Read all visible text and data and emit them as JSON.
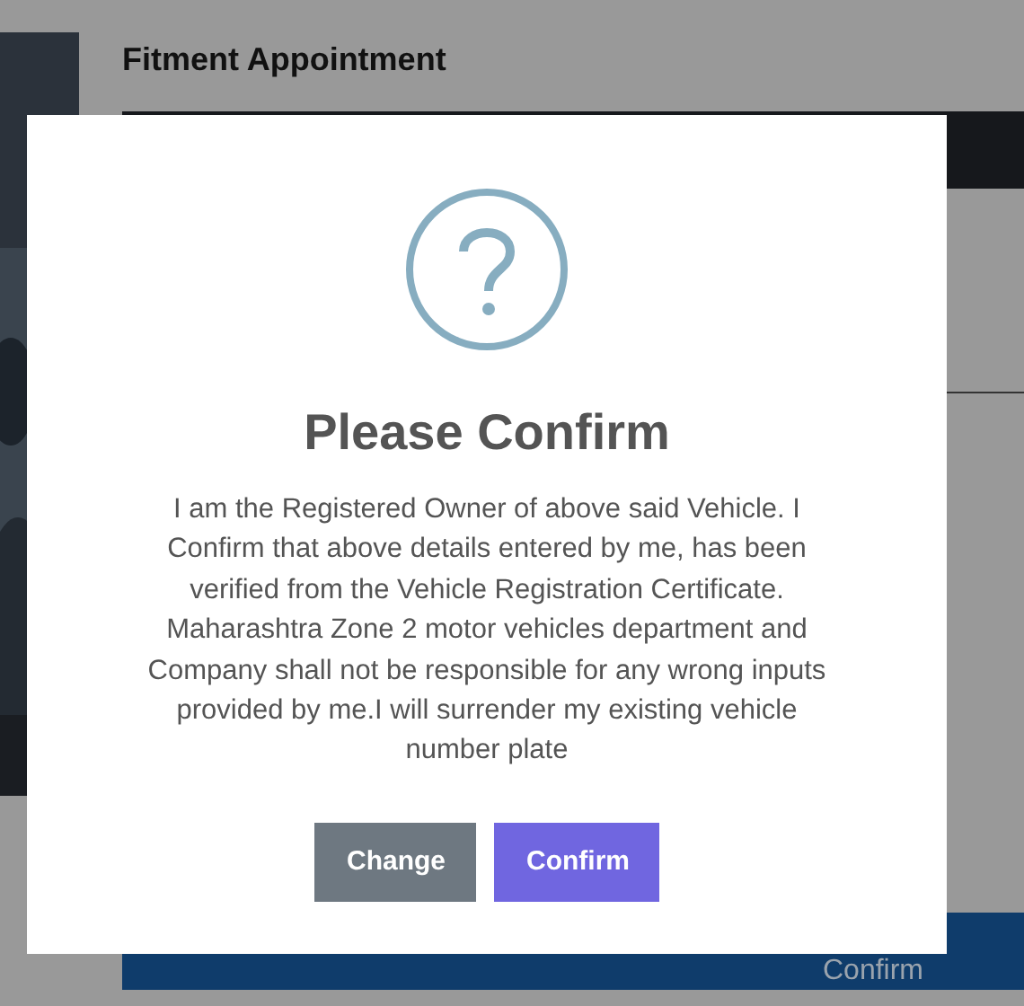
{
  "page": {
    "title": "Fitment Appointment",
    "footer_button": "Confirm"
  },
  "dialog": {
    "title": "Please Confirm",
    "message": "I am the Registered Owner of above said Vehicle. I Confirm that above details entered by me, has been verified from the Vehicle Registration Certificate. Maharashtra Zone 2 motor vehicles department and Company shall not be responsible for any wrong inputs provided by me.I will surrender my existing vehicle number plate",
    "buttons": [
      {
        "label": "Change",
        "kind": "cancel"
      },
      {
        "label": "Confirm",
        "kind": "confirm"
      }
    ]
  }
}
